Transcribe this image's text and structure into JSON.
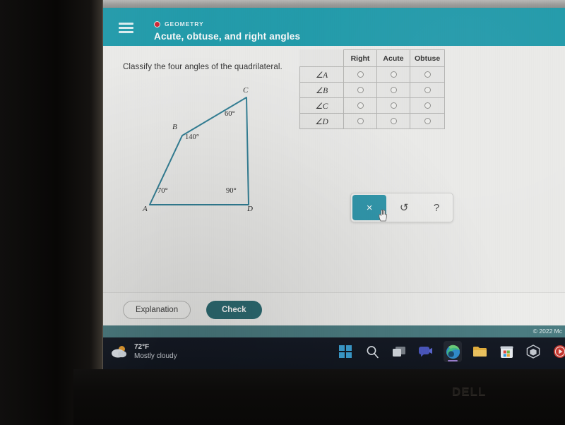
{
  "device": {
    "brand": "DELL"
  },
  "app_header": {
    "menu_icon": "hamburger-icon",
    "subject": "GEOMETRY",
    "lesson_title": "Acute, obtuse, and right angles",
    "expand_icon": "chevron-down-icon"
  },
  "content": {
    "question": "Classify the four angles of the quadrilateral.",
    "figure": {
      "type": "quadrilateral",
      "vertices": [
        {
          "label": "A",
          "angle": "70°"
        },
        {
          "label": "B",
          "angle": "140°"
        },
        {
          "label": "C",
          "angle": "60°"
        },
        {
          "label": "D",
          "angle": "90°"
        }
      ],
      "stroke_color": "#2e7f96"
    },
    "table": {
      "corner_header": "",
      "columns": [
        "Right",
        "Acute",
        "Obtuse"
      ],
      "rows": [
        {
          "label": "∠A",
          "selected": null
        },
        {
          "label": "∠B",
          "selected": null
        },
        {
          "label": "∠C",
          "selected": null
        },
        {
          "label": "∠D",
          "selected": null
        }
      ]
    },
    "toolbar": {
      "clear_label": "×",
      "undo_label": "↺",
      "help_label": "?",
      "active_color": "#2b97ad"
    }
  },
  "actions": {
    "explanation_label": "Explanation",
    "check_label": "Check",
    "check_color": "#2b6b72"
  },
  "footer": {
    "copyright": "© 2022 Mc"
  },
  "taskbar": {
    "weather": {
      "temperature": "72°F",
      "condition": "Mostly cloudy",
      "icon": "sun-cloud-icon"
    },
    "items": [
      {
        "name": "start-button",
        "icon": "windows-logo-icon"
      },
      {
        "name": "search-button",
        "icon": "search-icon"
      },
      {
        "name": "task-view-button",
        "icon": "task-view-icon"
      },
      {
        "name": "chat-button",
        "icon": "chat-video-icon"
      },
      {
        "name": "edge-button",
        "icon": "edge-browser-icon"
      },
      {
        "name": "file-explorer-button",
        "icon": "folder-icon"
      },
      {
        "name": "microsoft-store-button",
        "icon": "store-icon"
      },
      {
        "name": "3d-viewer-button",
        "icon": "cube-icon"
      },
      {
        "name": "media-player-button",
        "icon": "play-circle-icon"
      }
    ]
  }
}
